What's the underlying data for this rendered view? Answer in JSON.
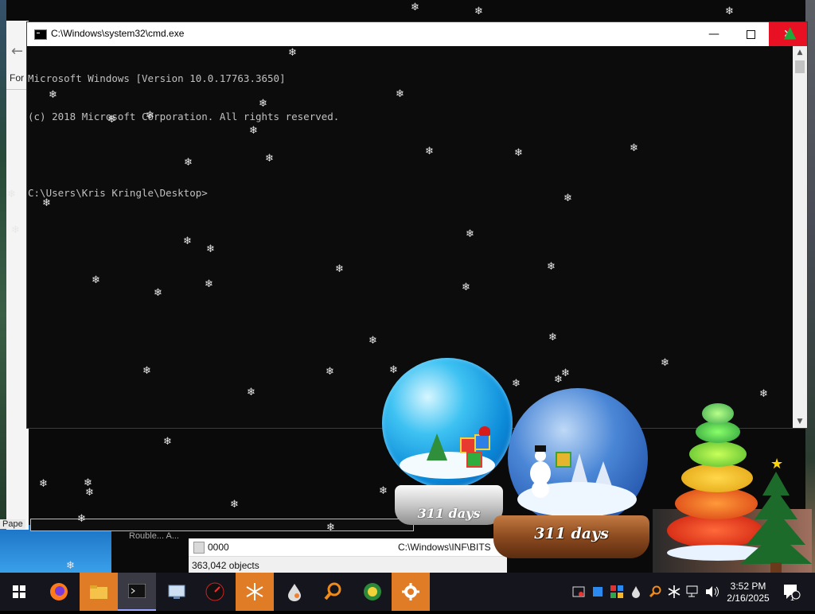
{
  "cmd": {
    "title": "C:\\Windows\\system32\\cmd.exe",
    "lines": [
      "Microsoft Windows [Version 10.0.17763.3650]",
      "(c) 2018 Microsoft Corporation. All rights reserved.",
      "",
      "C:\\Users\\Kris Kringle\\Desktop>"
    ],
    "controls": {
      "minimize": "—",
      "maximize": "",
      "close": "✕"
    }
  },
  "background_app": {
    "back_arrow": "←",
    "partial_label": "For",
    "paper_label": "Pape",
    "partial_text": "Rouble... A..."
  },
  "explorer": {
    "file_name": "0000",
    "path": "C:\\Windows\\INF\\BITS",
    "status": "363,042 objects"
  },
  "globes": {
    "left_days": "311 days",
    "right_days": "311 days"
  },
  "taskbar": {
    "time": "3:52 PM",
    "date": "2/16/2025",
    "notification_count": "1"
  },
  "colors": {
    "cmd_bg": "#0c0c0c",
    "cmd_text": "#c0c0c0",
    "close_red": "#e81123",
    "taskbar": "#15151d",
    "accent_orange": "#e07b26"
  }
}
